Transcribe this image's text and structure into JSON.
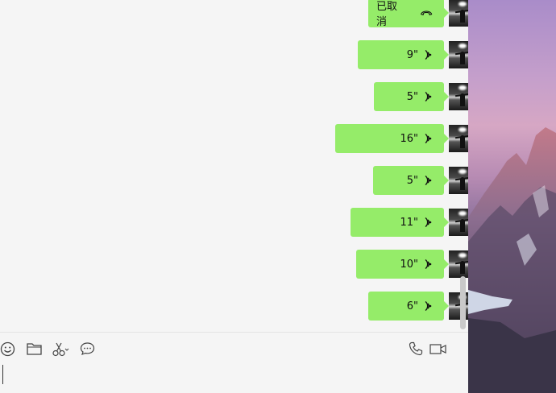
{
  "messages": [
    {
      "text": "已取消",
      "kind": "call-cancelled"
    },
    {
      "text": "9\"",
      "kind": "voice"
    },
    {
      "text": "5\"",
      "kind": "voice"
    },
    {
      "text": "16\"",
      "kind": "voice"
    },
    {
      "text": "5\"",
      "kind": "voice"
    },
    {
      "text": "11\"",
      "kind": "voice"
    },
    {
      "text": "10\"",
      "kind": "voice"
    },
    {
      "text": "6\"",
      "kind": "voice"
    }
  ],
  "toolbar": {
    "left_icons": [
      "emoji-icon",
      "folder-icon",
      "scissors-icon",
      "chat-bubble-icon"
    ],
    "right_icons": [
      "phone-icon",
      "video-camera-icon"
    ]
  },
  "colors": {
    "bubble": "#95ec69",
    "chat_background": "#f5f5f5"
  }
}
